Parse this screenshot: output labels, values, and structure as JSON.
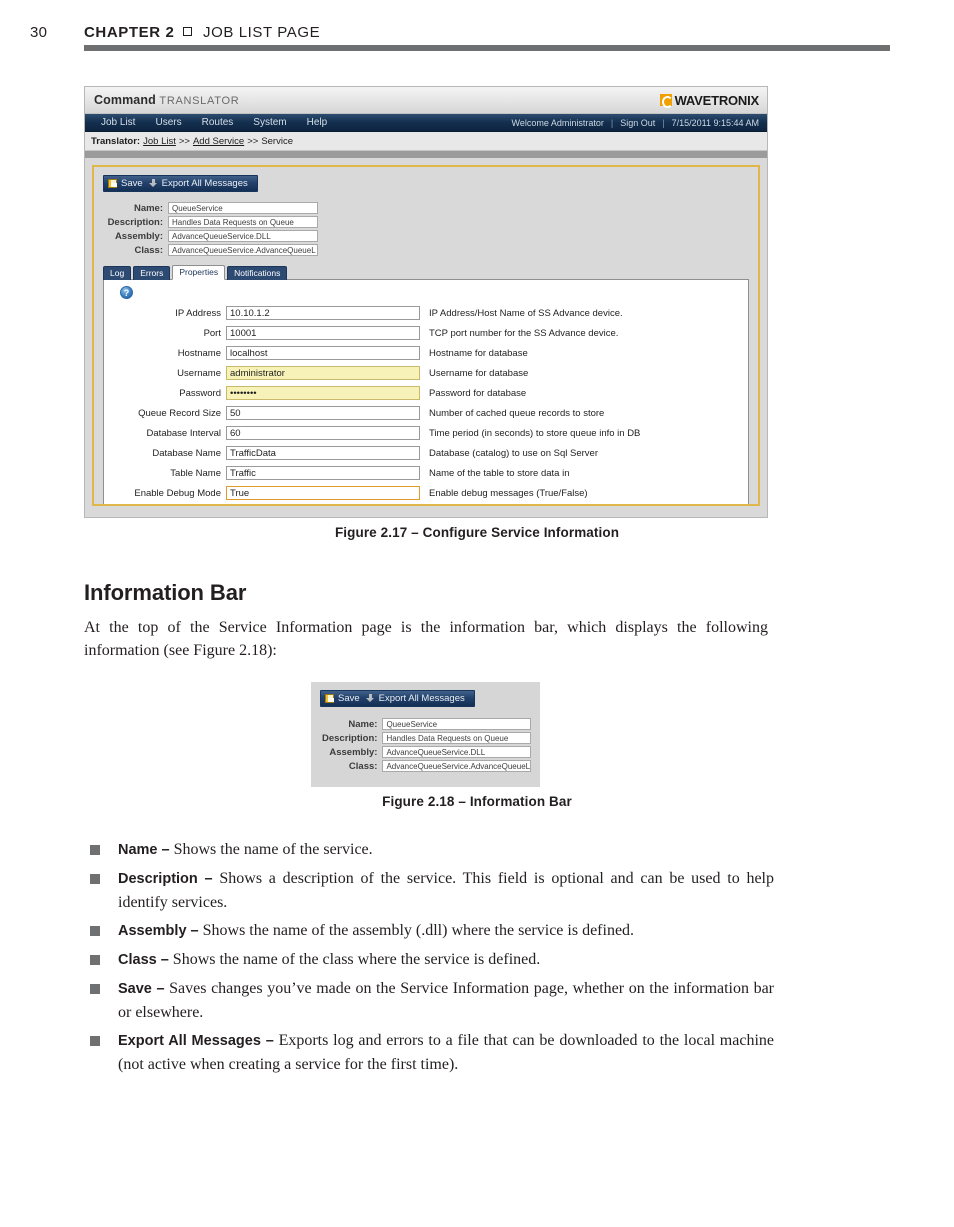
{
  "running_head": {
    "page_number": "30",
    "chapter": "CHAPTER 2",
    "section": "JOB LIST PAGE"
  },
  "app": {
    "brand_name": "Command",
    "brand_sub": "TRANSLATOR",
    "logo_text": "WAVETRONIX",
    "nav_items": [
      {
        "label": "Job List"
      },
      {
        "label": "Users"
      },
      {
        "label": "Routes"
      },
      {
        "label": "System"
      },
      {
        "label": "Help"
      }
    ],
    "welcome": "Welcome Administrator",
    "sign_out": "Sign Out",
    "timestamp": "7/15/2011 9:15:44 AM",
    "separator": "|",
    "breadcrumb": {
      "prefix": "Translator:",
      "link1": "Job List",
      "arrow1": ">>",
      "link2": "Add Service",
      "arrow2": ">>",
      "current": "Service"
    },
    "toolbar": {
      "save_label": "Save",
      "export_label": "Export All Messages",
      "save_icon": "floppy-disk-icon",
      "export_icon": "download-arrow-icon"
    },
    "info_bar": [
      {
        "label": "Name:",
        "value": "QueueService"
      },
      {
        "label": "Description:",
        "value": "Handles Data Requests on Queue"
      },
      {
        "label": "Assembly:",
        "value": "AdvanceQueueService.DLL"
      },
      {
        "label": "Class:",
        "value": "AdvanceQueueService.AdvanceQueueL"
      }
    ],
    "tabs": [
      {
        "label": "Log",
        "active": false
      },
      {
        "label": "Errors",
        "active": false
      },
      {
        "label": "Properties",
        "active": true
      },
      {
        "label": "Notifications",
        "active": false
      }
    ],
    "help_icon_glyph": "?",
    "properties": [
      {
        "label": "IP Address",
        "value": "10.10.1.2",
        "desc": "IP Address/Host Name of SS Advance device."
      },
      {
        "label": "Port",
        "value": "10001",
        "desc": "TCP port number for the SS Advance device."
      },
      {
        "label": "Hostname",
        "value": "localhost",
        "desc": "Hostname for database"
      },
      {
        "label": "Username",
        "value": "administrator",
        "desc": "Username for database"
      },
      {
        "label": "Password",
        "value": "••••••••",
        "desc": "Password for database"
      },
      {
        "label": "Queue Record Size",
        "value": "50",
        "desc": "Number of cached queue records to store"
      },
      {
        "label": "Database Interval",
        "value": "60",
        "desc": "Time period (in seconds) to store queue info in DB"
      },
      {
        "label": "Database Name",
        "value": "TrafficData",
        "desc": "Database (catalog) to use on Sql Server"
      },
      {
        "label": "Table Name",
        "value": "Traffic",
        "desc": "Name of the table to store data in"
      },
      {
        "label": "Enable Debug Mode",
        "value": "True",
        "desc": "Enable debug messages (True/False)"
      }
    ]
  },
  "captions": {
    "fig217": "Figure 2.17 – Configure Service Information",
    "fig218": "Figure 2.18 – Information Bar"
  },
  "section": {
    "heading": "Information Bar",
    "paragraph": "At the top of the Service Information page is the information bar, which displays the following information (see Figure 2.18):"
  },
  "bullets": [
    {
      "term": "Name –",
      "text": " Shows the name of the service."
    },
    {
      "term": "Description –",
      "text": " Shows a description of the service. This field is optional and can be used to help identify services."
    },
    {
      "term": "Assembly –",
      "text": " Shows the name of the assembly (.dll) where the service is defined."
    },
    {
      "term": "Class –",
      "text": " Shows the name of the class where the service is defined."
    },
    {
      "term": "Save –",
      "text": " Saves changes you’ve made on the Service Information page, whether on the information bar or elsewhere."
    },
    {
      "term": "Export All Messages –",
      "text": " Exports log and errors to a file that can be downloaded to the local machine (not active when creating a service for the first time)."
    }
  ],
  "colors": {
    "accent_gold": "#e0b84a",
    "nav_dark_blue": "#14304f",
    "logo_orange": "#f0a000",
    "highlight_yellow": "#f7f3b8",
    "rule_grey": "#6f7072"
  }
}
